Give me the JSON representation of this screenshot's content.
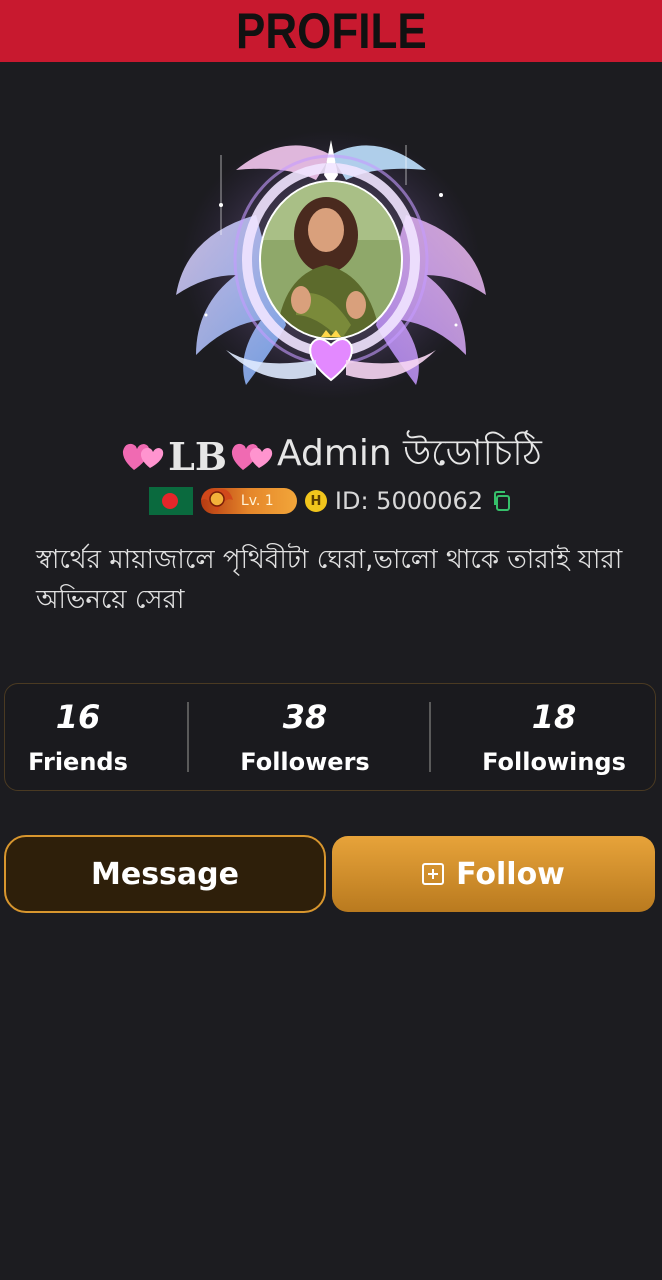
{
  "header": {
    "title": "PROFILE"
  },
  "profile": {
    "name_prefix": "LB",
    "name_suffix": "Admin উডোচিঠি",
    "level": "Lv. 1",
    "h_badge": "H",
    "id_text": "ID: 5000062",
    "bio": "স্বার্থের মায়াজালে পৃথিবীটা ঘেরা,ভালো থাকে তারাই যারা অভিনয়ে সেরা"
  },
  "stats": [
    {
      "value": "16",
      "label": "Friends"
    },
    {
      "value": "38",
      "label": "Followers"
    },
    {
      "value": "18",
      "label": "Followings"
    }
  ],
  "actions": {
    "message_label": "Message",
    "follow_label": "Follow"
  },
  "colors": {
    "banner": "#c8192f",
    "accent": "#e7a33a",
    "background": "#1c1c20"
  }
}
